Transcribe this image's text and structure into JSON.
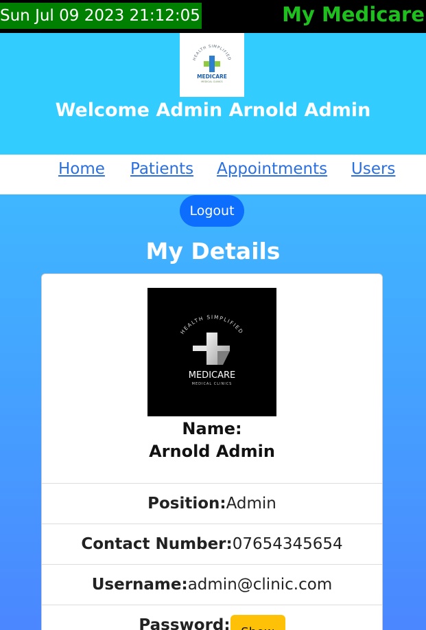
{
  "topbar": {
    "datetime": "Sun Jul 09 2023 21:12:05",
    "brand": "My Medicare"
  },
  "header": {
    "logo": {
      "tagline": "HEALTH SIMPLIFIED",
      "name": "MEDICARE",
      "sub": "MEDICAL CLINICS"
    },
    "welcome": "Welcome Admin Arnold Admin"
  },
  "nav": {
    "items": [
      "Home",
      "Patients",
      "Appointments",
      "Users"
    ]
  },
  "logout_label": "Logout",
  "section_title": "My Details",
  "profile": {
    "logo": {
      "tagline": "HEALTH SIMPLIFIED",
      "name": "MEDICARE",
      "sub": "MEDICAL CLINICS"
    },
    "name_label": "Name:",
    "name": "Arnold Admin",
    "fields": [
      {
        "label": "Position:",
        "value": "Admin"
      },
      {
        "label": "Contact Number:",
        "value": "07654345654"
      },
      {
        "label": "Username:",
        "value": "admin@clinic.com"
      },
      {
        "label": "Password:",
        "button": "Show"
      }
    ]
  },
  "colors": {
    "header_bg": "#33ccff",
    "clock_bg": "#008000",
    "brand": "#1ec01e",
    "primary": "#0d6efd",
    "warning": "#ffc107"
  }
}
